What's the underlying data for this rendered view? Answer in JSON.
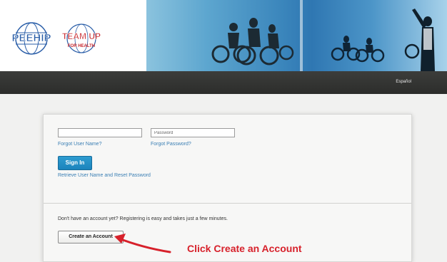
{
  "header": {
    "logo_left_text": "PEEHIP",
    "logo_right_text_line1": "TEAM UP",
    "logo_right_text_line2": "FOR HEALTH",
    "language_link": "Español"
  },
  "login": {
    "username_placeholder": "",
    "password_placeholder": "Password",
    "forgot_username": "Forgot User Name?",
    "forgot_password": "Forgot Password?",
    "sign_in": "Sign In",
    "retrieve_link": "Retrieve User Name and Reset Password"
  },
  "register": {
    "prompt": "Don't have an account yet? Registering is easy and takes just a few minutes.",
    "create_button": "Create an Account"
  },
  "annotation": {
    "text": "Click Create an Account",
    "color": "#d7212b"
  },
  "colors": {
    "navbar": "#2f302e",
    "link": "#3b7fb4",
    "sign_in_button": "#1f8cc4",
    "logo_blue": "#2a5ea8",
    "logo_red": "#c8282e"
  }
}
